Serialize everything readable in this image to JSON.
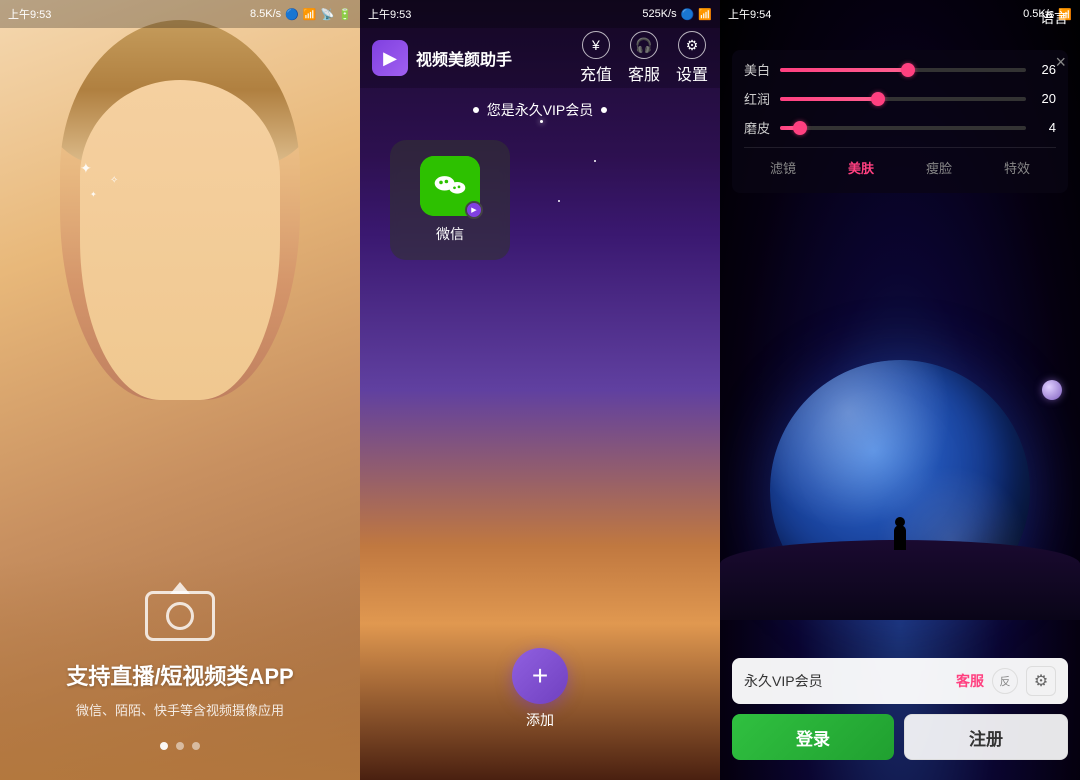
{
  "panel1": {
    "status_time": "上午9:53",
    "status_speed": "8.5K/s",
    "title": "支持直播/短视频类APP",
    "subtitle": "微信、陌陌、快手等含视频摄像应用",
    "dots": [
      true,
      false,
      false
    ],
    "camera_icon": "camera"
  },
  "panel2": {
    "status_time": "上午9:53",
    "status_speed": "525K/s",
    "app_name": "视频美颜助手",
    "action_recharge": "充值",
    "action_service": "客服",
    "action_settings": "设置",
    "vip_text": "您是永久VIP会员",
    "wechat_label": "微信",
    "add_label": "添加",
    "add_plus": "+"
  },
  "panel3": {
    "status_time": "上午9:54",
    "status_speed": "0.5K/s",
    "lang_btn": "语言",
    "close_btn": "×",
    "sliders": [
      {
        "label": "美白",
        "value": 26,
        "percent": 52
      },
      {
        "label": "红润",
        "value": 20,
        "percent": 40
      },
      {
        "label": "磨皮",
        "value": 4,
        "percent": 8
      }
    ],
    "tabs": [
      {
        "label": "滤镜",
        "active": false
      },
      {
        "label": "美肤",
        "active": true
      },
      {
        "label": "瘦脸",
        "active": false
      },
      {
        "label": "特效",
        "active": false
      }
    ],
    "vip_label": "永久VIP会员",
    "service_btn": "客服",
    "login_btn": "登录",
    "register_btn": "注册"
  }
}
